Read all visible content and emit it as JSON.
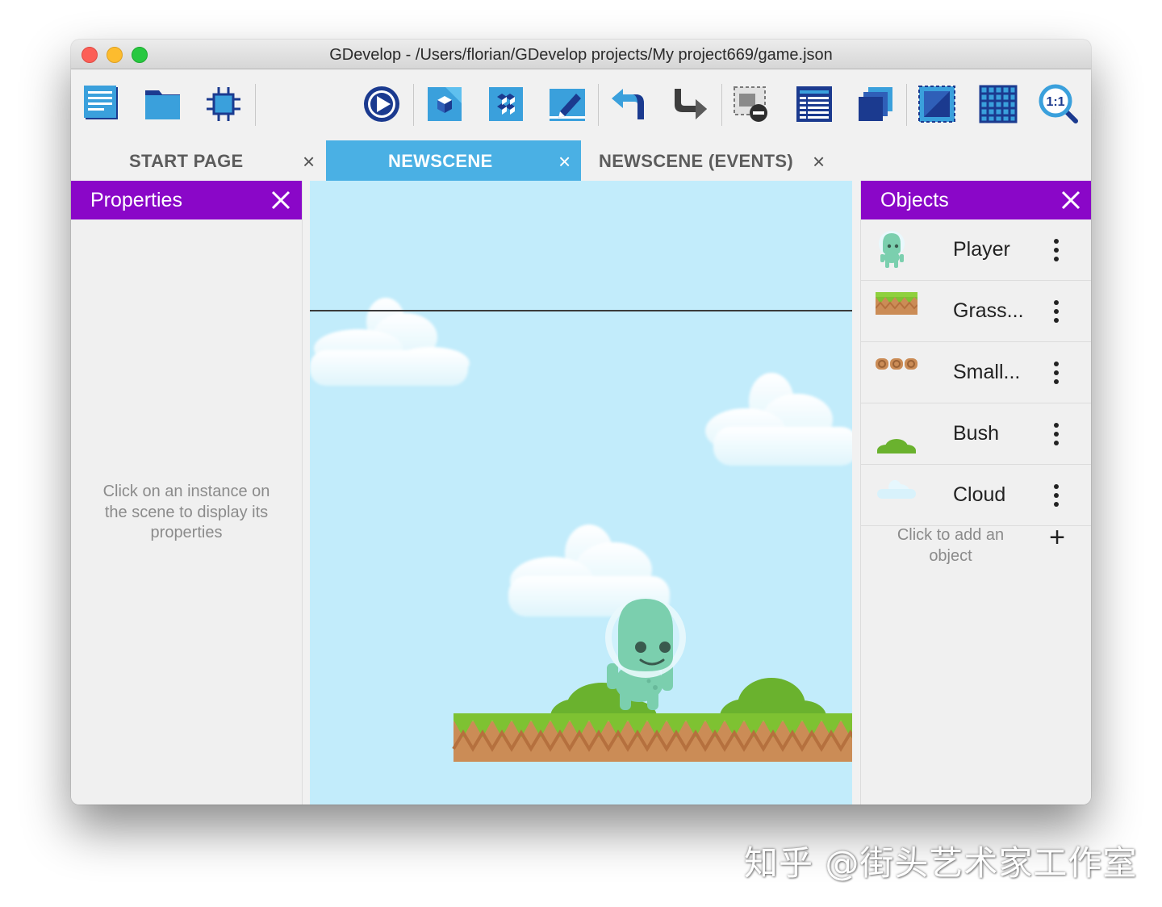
{
  "window": {
    "title": "GDevelop - /Users/florian/GDevelop projects/My project669/game.json"
  },
  "toolbar": {
    "icons": [
      "project-manager-icon",
      "open-folder-icon",
      "debug-chip-icon",
      "preview-play-icon",
      "scene-editor-icon",
      "instances-editor-icon",
      "edit-object-icon",
      "undo-icon",
      "redo-icon",
      "delete-instance-icon",
      "events-list-icon",
      "layers-icon",
      "window-mask-icon",
      "grid-icon",
      "zoom-reset-icon"
    ],
    "zoom_label": "1:1"
  },
  "tabs": [
    {
      "label": "START PAGE",
      "active": false
    },
    {
      "label": "NEWSCENE",
      "active": true
    },
    {
      "label": "NEWSCENE (EVENTS)",
      "active": false
    }
  ],
  "tab_close_glyph": "×",
  "properties": {
    "title": "Properties",
    "empty_hint": "Click on an instance on the scene to display its properties"
  },
  "objects": {
    "title": "Objects",
    "items": [
      {
        "name": "Player",
        "icon": "player-sprite-icon"
      },
      {
        "name": "Grass...",
        "icon": "grass-tile-icon"
      },
      {
        "name": "Small...",
        "icon": "small-platform-icon"
      },
      {
        "name": "Bush",
        "icon": "bush-icon"
      },
      {
        "name": "Cloud",
        "icon": "cloud-icon"
      }
    ],
    "add_hint": "Click to add an object",
    "add_glyph": "+"
  },
  "colors": {
    "panel_header": "#8a07c8",
    "active_tab": "#4ab0e4",
    "scene_sky": "#c2ecfb"
  },
  "watermark": "知乎 @街头艺术家工作室"
}
